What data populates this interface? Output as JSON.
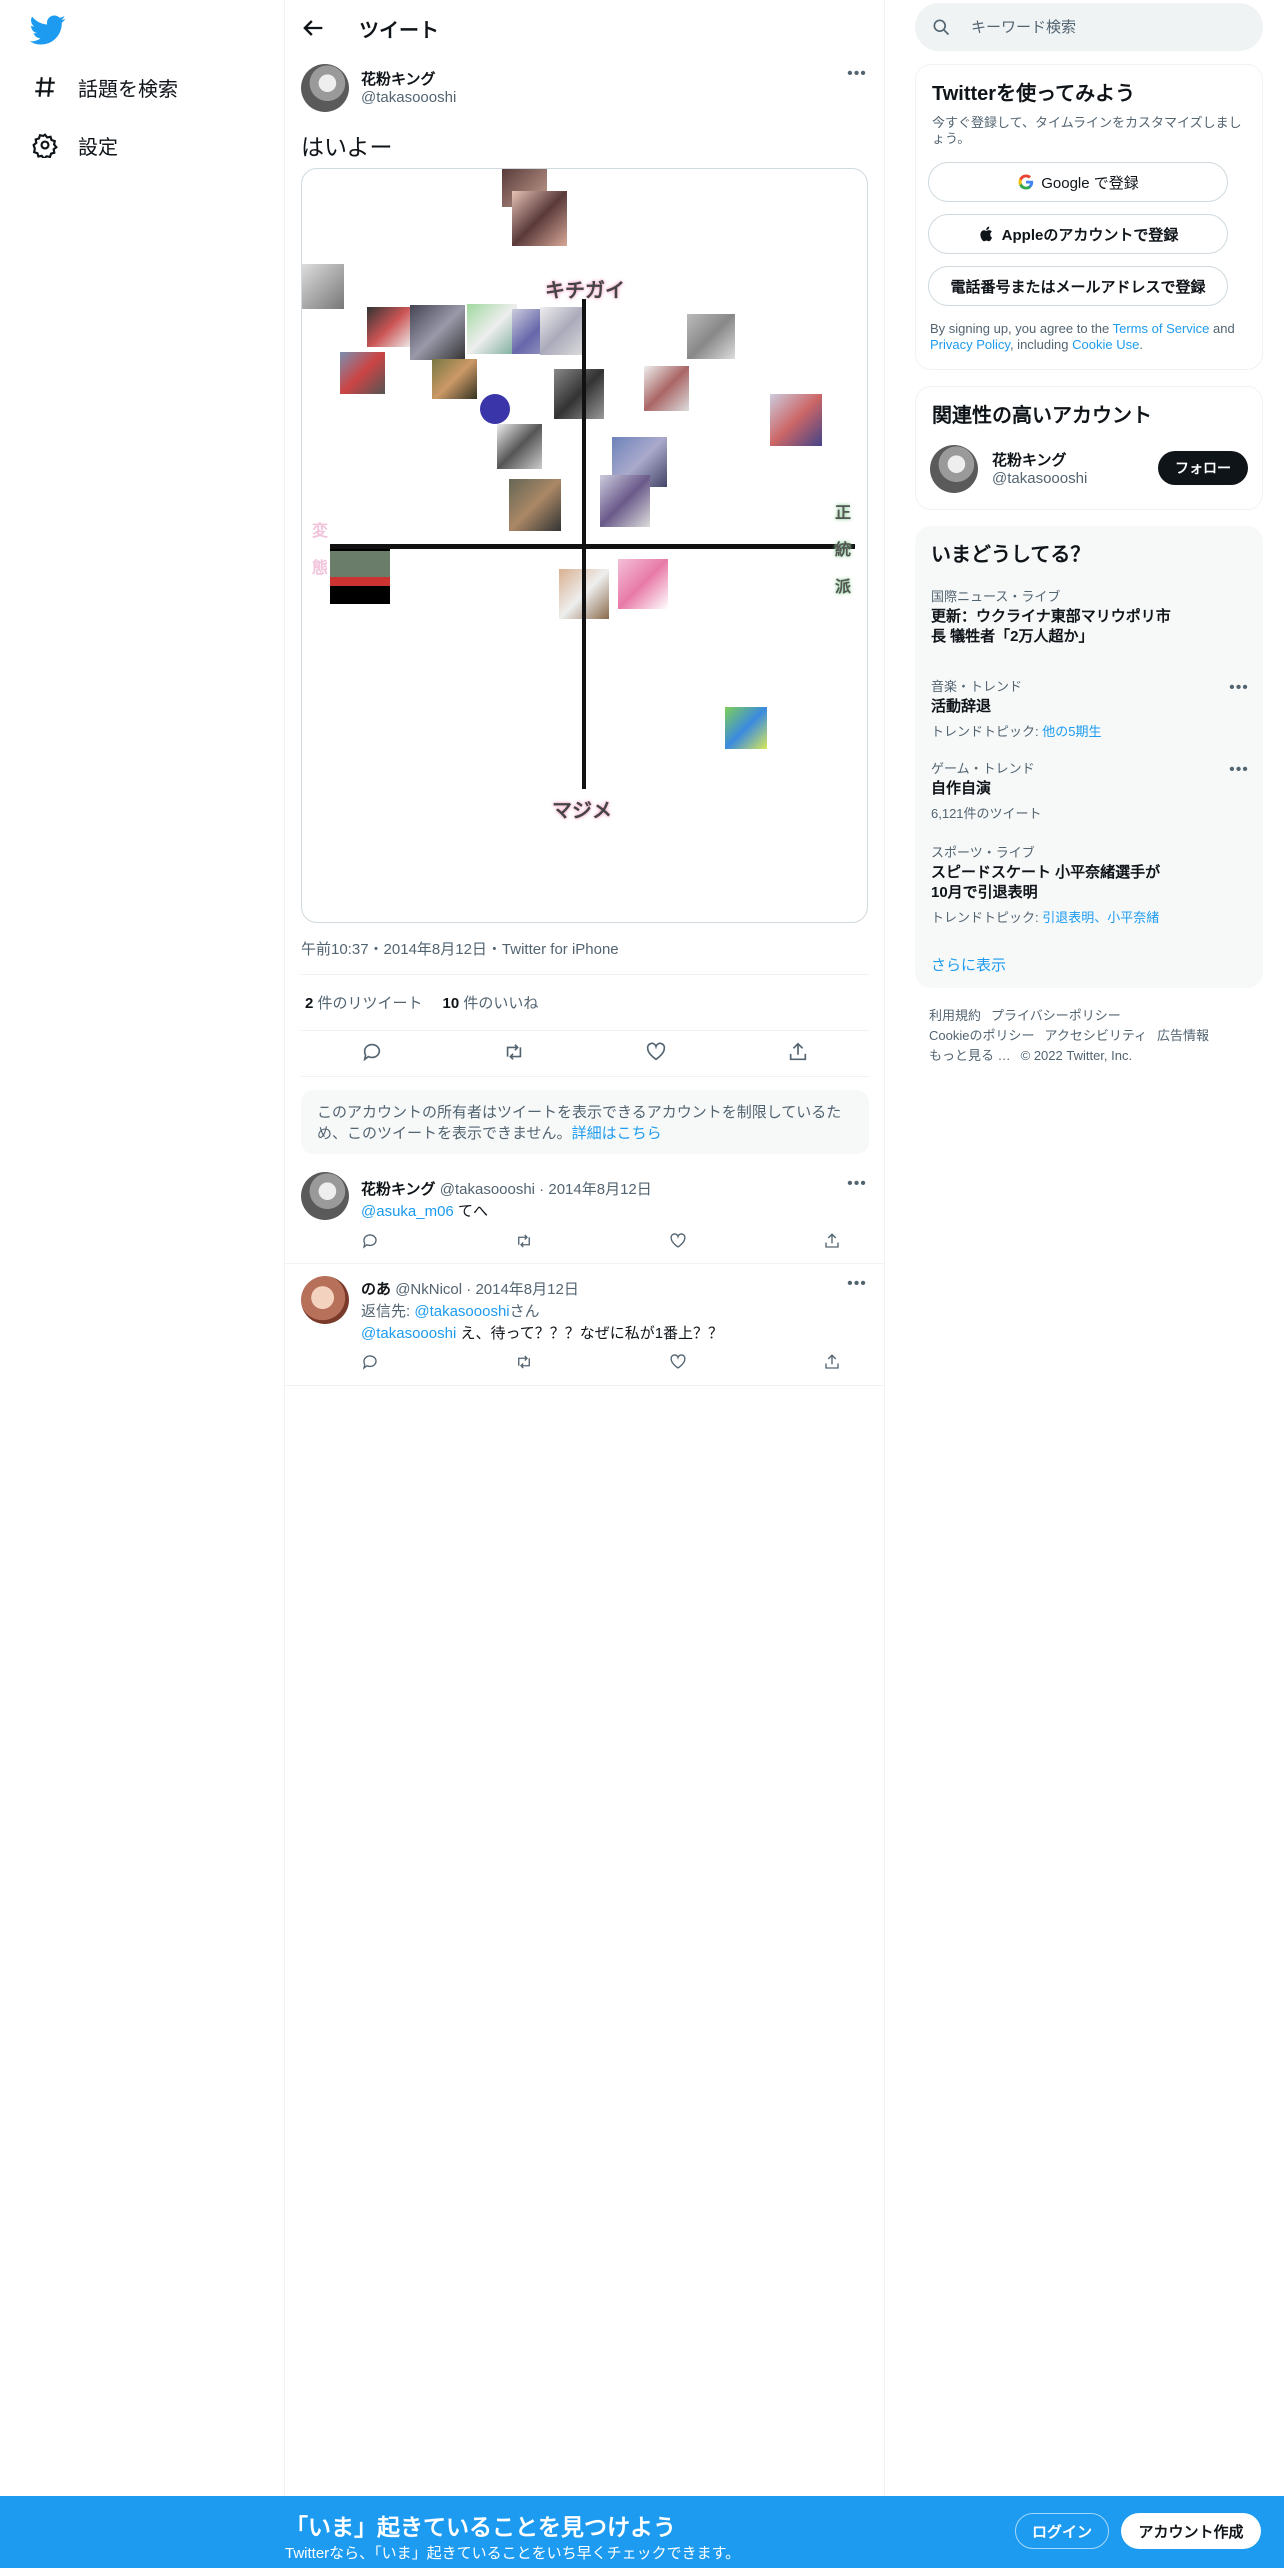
{
  "sidebar": {
    "items": [
      {
        "label": "話題を検索",
        "icon": "hashtag-icon"
      },
      {
        "label": "設定",
        "icon": "gear-icon"
      }
    ]
  },
  "header": {
    "title": "ツイート"
  },
  "tweet": {
    "name": "花粉キング",
    "handle": "@takasoooshi",
    "text": "はいよー",
    "image_labels": {
      "top": "キチガイ",
      "bottom": "マジメ",
      "right": [
        "正",
        "統",
        "派"
      ],
      "left": [
        "変",
        "態"
      ]
    },
    "meta": "午前10:37・2014年8月12日・Twitter for iPhone",
    "retweets_count": "2",
    "retweets_label": "件のリツイート",
    "likes_count": "10",
    "likes_label": "件のいいね"
  },
  "notice": {
    "text": "このアカウントの所有者はツイートを表示できるアカウントを制限しているため、このツイートを表示できません。",
    "link": "詳細はこちら"
  },
  "replies": [
    {
      "name": "花粉キング",
      "handle": "@takasoooshi",
      "date": "2014年8月12日",
      "mention": "@asuka_m06",
      "text": " てへ"
    },
    {
      "name": "のあ",
      "handle": "@NkNicol",
      "date": "2014年8月12日",
      "reply_to_prefix": "返信先: ",
      "reply_to": "@takasoooshi",
      "reply_to_suffix": "さん",
      "mention": "@takasoooshi",
      "text": " え、待って？？？なぜに私が1番上？？"
    }
  ],
  "search": {
    "placeholder": "キーワード検索"
  },
  "signup_card": {
    "title": "Twitterを使ってみよう",
    "subtitle": "今すぐ登録して、タイムラインをカスタマイズしましょう。",
    "google": "Google で登録",
    "apple": "Appleのアカウントで登録",
    "phone": "電話番号またはメールアドレスで登録",
    "legal_1": "By signing up, you agree to the ",
    "tos": "Terms of Service",
    "legal_2": " and ",
    "privacy": "Privacy Policy",
    "legal_3": ", including ",
    "cookie": "Cookie Use",
    "legal_4": "."
  },
  "related": {
    "title": "関連性の高いアカウント",
    "name": "花粉キング",
    "handle": "@takasoooshi",
    "follow": "フォロー"
  },
  "trends": {
    "title": "いまどうしてる？",
    "items": [
      {
        "category": "国際ニュース・ライブ",
        "title": "更新：ウクライナ東部マリウポリ市長 犠牲者「2万人超か」",
        "sub_prefix": "",
        "sub_link": ""
      },
      {
        "category": "音楽・トレンド",
        "title": "活動辞退",
        "sub_prefix": "トレンドトピック: ",
        "sub_link": "他の5期生"
      },
      {
        "category": "ゲーム・トレンド",
        "title": "自作自演",
        "sub_prefix": "6,121件のツイート",
        "sub_link": ""
      },
      {
        "category": "スポーツ・ライブ",
        "title": "スピードスケート 小平奈緒選手が10月で引退表明",
        "sub_prefix": "トレンドトピック: ",
        "sub_link": "引退表明、小平奈緒"
      }
    ],
    "show_more": "さらに表示"
  },
  "footer": {
    "links": [
      "利用規約",
      "プライバシーポリシー",
      "Cookieのポリシー",
      "アクセシビリティ",
      "広告情報",
      "もっと見る …"
    ],
    "copyright": "© 2022 Twitter, Inc."
  },
  "bottom_bar": {
    "title": "「いま」起きていることを見つけよう",
    "subtitle": "Twitterなら、「いま」起きていることをいち早くチェックできます。",
    "login": "ログイン",
    "signup": "アカウント作成"
  },
  "colors": {
    "accent": "#1d9bf0",
    "text": "#0f1419",
    "secondary": "#536471"
  }
}
